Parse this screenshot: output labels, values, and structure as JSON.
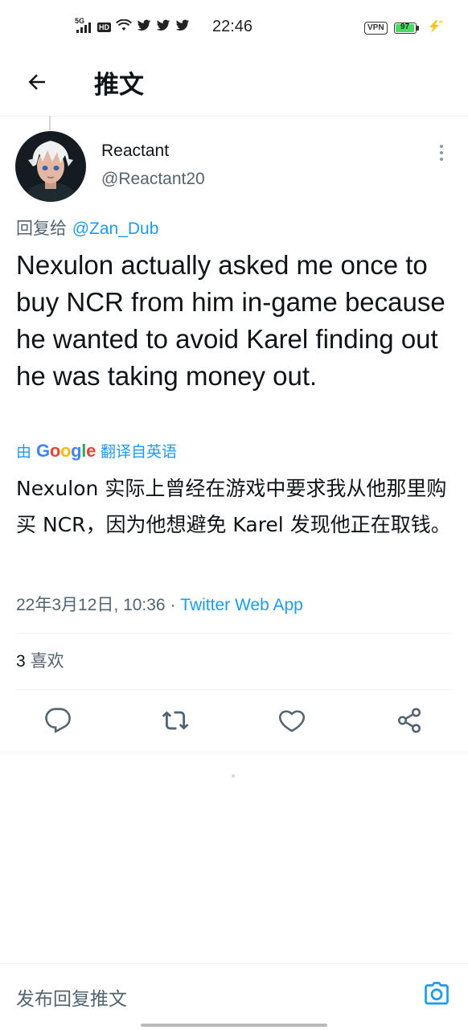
{
  "status_bar": {
    "network": "5G",
    "hd": "HD",
    "time": "22:46",
    "vpn": "VPN",
    "battery": "97",
    "battery_level": 0.97,
    "icons": [
      "signal-icon",
      "wifi-icon",
      "twitter-icon",
      "twitter-icon",
      "twitter-icon",
      "charging-icon"
    ]
  },
  "header": {
    "back_icon": "arrow-left-icon",
    "title": "推文"
  },
  "tweet": {
    "author": {
      "display_name": "Reactant",
      "handle": "@Reactant20"
    },
    "reply_to_label": "回复给",
    "reply_to_handle": "@Zan_Dub",
    "text": "Nexulon actually asked me once to buy NCR from him in-game because he wanted to avoid Karel finding out he was taking money out.",
    "translation_prefix": "由",
    "translation_brand": "Google",
    "translation_suffix": "翻译自英语",
    "translation": "Nexulon 实际上曾经在游戏中要求我从他那里购买 NCR，因为他想避免 Karel 发现他正在取钱。",
    "date": "22年3月12日, 10:36",
    "separator": " · ",
    "source": "Twitter Web App",
    "likes_count": "3",
    "likes_label": "喜欢"
  },
  "actions": [
    "reply-icon",
    "retweet-icon",
    "like-icon",
    "share-icon"
  ],
  "reply_bar": {
    "placeholder": "发布回复推文",
    "camera_icon": "camera-icon"
  },
  "colors": {
    "accent": "#1d9bf0",
    "text_primary": "#0f1419",
    "text_secondary": "#536471",
    "divider": "#eff3f4",
    "battery": "#4cd964"
  }
}
